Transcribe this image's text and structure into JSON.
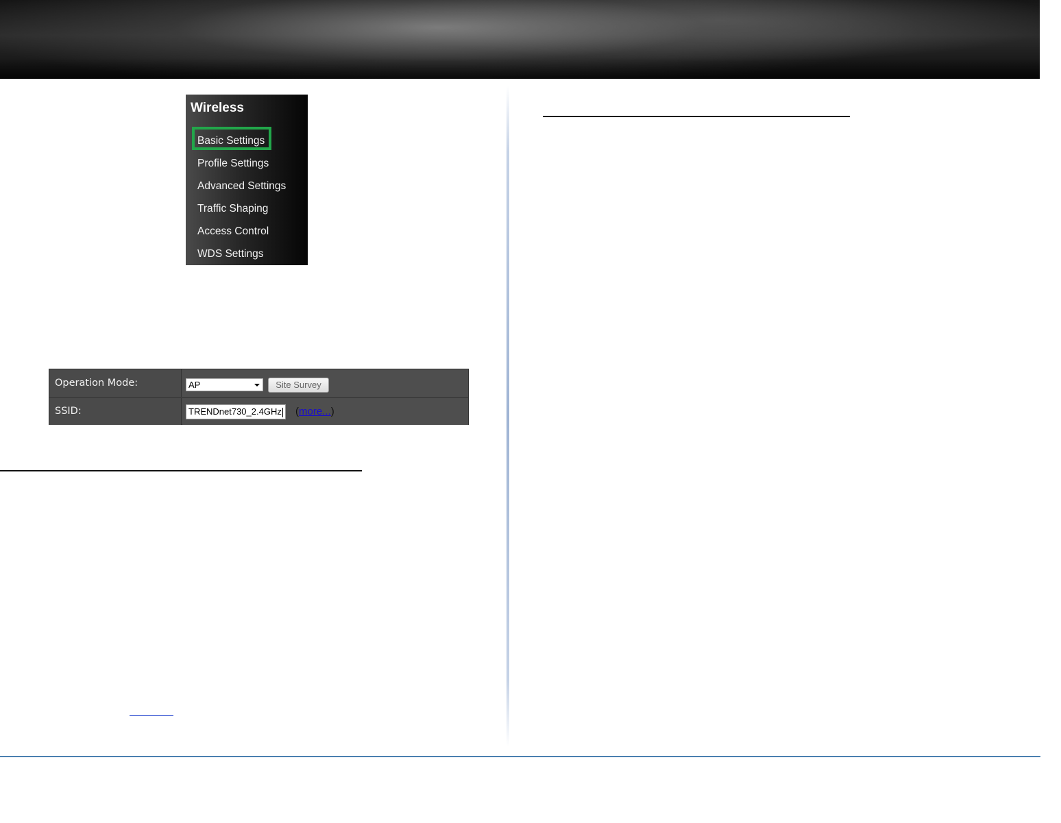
{
  "menu": {
    "title": "Wireless",
    "items": [
      {
        "label": "Basic Settings",
        "selected": true
      },
      {
        "label": "Profile Settings"
      },
      {
        "label": "Advanced Settings"
      },
      {
        "label": "Traffic Shaping"
      },
      {
        "label": "Access Control"
      },
      {
        "label": "WDS Settings"
      }
    ],
    "highlight_color": "#22a64a"
  },
  "form": {
    "operation_mode_label": "Operation Mode:",
    "operation_mode_value": "AP",
    "site_survey_label": "Site Survey",
    "ssid_label": "SSID:",
    "ssid_value": "TRENDnet730_2.4GHz",
    "more_open": "(",
    "more_link": "more...",
    "more_close": ")"
  },
  "colors": {
    "footer_line": "#4a80b0",
    "link": "#1a0dcc"
  }
}
